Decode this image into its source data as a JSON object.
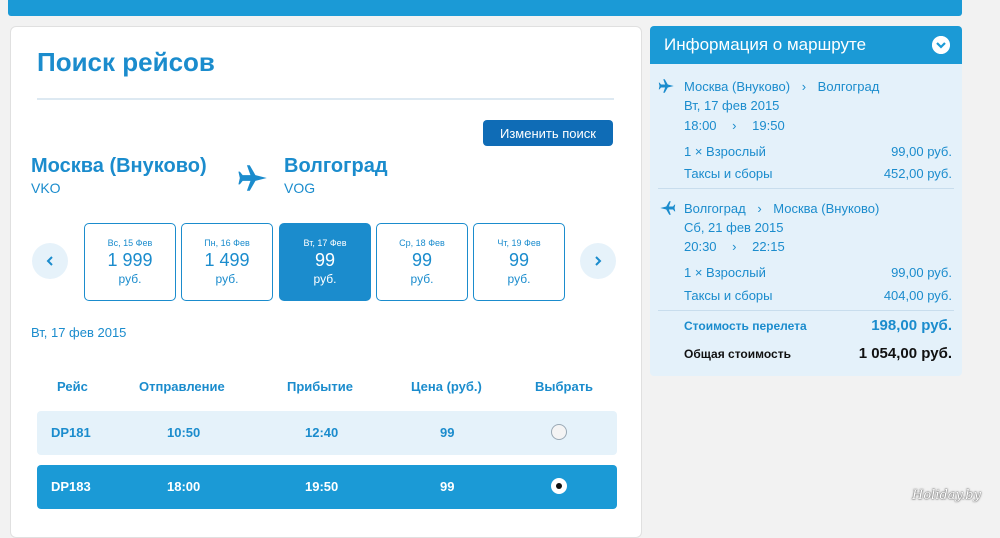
{
  "page": {
    "title": "Поиск рейсов",
    "change_search": "Изменить поиск"
  },
  "route": {
    "from_city": "Москва (Внуково)",
    "from_code": "VKO",
    "to_city": "Волгоград",
    "to_code": "VOG"
  },
  "dates": [
    {
      "label": "Вс, 15 Фев",
      "price": "1 999",
      "currency": "руб.",
      "active": false
    },
    {
      "label": "Пн, 16 Фев",
      "price": "1 499",
      "currency": "руб.",
      "active": false
    },
    {
      "label": "Вт, 17 Фев",
      "price": "99",
      "currency": "руб.",
      "active": true
    },
    {
      "label": "Ср, 18 Фев",
      "price": "99",
      "currency": "руб.",
      "active": false
    },
    {
      "label": "Чт, 19 Фев",
      "price": "99",
      "currency": "руб.",
      "active": false
    }
  ],
  "selected_date": "Вт, 17 фев 2015",
  "table": {
    "headers": [
      "Рейс",
      "Отправление",
      "Прибытие",
      "Цена (руб.)",
      "Выбрать"
    ],
    "rows": [
      {
        "flight": "DP181",
        "departure": "10:50",
        "arrival": "12:40",
        "price": "99",
        "selected": false
      },
      {
        "flight": "DP183",
        "departure": "18:00",
        "arrival": "19:50",
        "price": "99",
        "selected": true
      }
    ]
  },
  "sidebar": {
    "title": "Информация о маршруте",
    "outbound": {
      "from": "Москва (Внуково)",
      "to": "Волгоград",
      "date": "Вт, 17 фев 2015",
      "depart": "18:00",
      "arrive": "19:50",
      "passenger_label": "1 × Взрослый",
      "passenger_price": "99,00 руб.",
      "taxes_label": "Таксы и сборы",
      "taxes_price": "452,00 руб."
    },
    "return": {
      "from": "Волгоград",
      "to": "Москва (Внуково)",
      "date": "Сб, 21 фев 2015",
      "depart": "20:30",
      "arrive": "22:15",
      "passenger_label": "1 × Взрослый",
      "passenger_price": "99,00 руб.",
      "taxes_label": "Таксы и сборы",
      "taxes_price": "404,00 руб."
    },
    "flight_cost_label": "Стоимость перелета",
    "flight_cost": "198,00 руб.",
    "total_label": "Общая стоимость",
    "total": "1 054,00 руб."
  },
  "watermark": "Holiday.by",
  "colors": {
    "accent": "#1b8ccd",
    "header": "#1b9ad6",
    "button": "#0f6cb6"
  }
}
